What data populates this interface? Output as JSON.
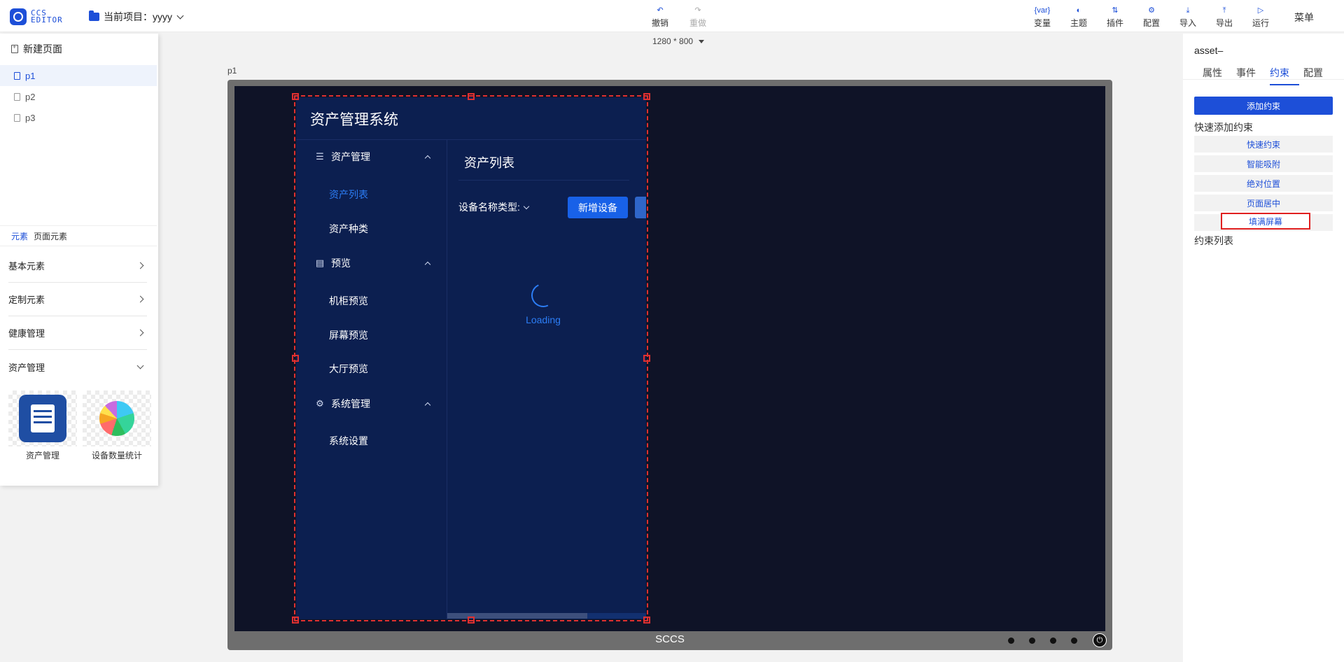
{
  "app": {
    "logo_text": "CCS EDITOR",
    "project_label": "当前项目：yyyy"
  },
  "toolbar": {
    "undo": "撤销",
    "redo": "重做",
    "variable": "变量",
    "theme": "主题",
    "plugin": "插件",
    "config": "配置",
    "import": "导入",
    "export": "导出",
    "run": "运行",
    "menu": "菜单"
  },
  "icons": {
    "undo": "undo-icon",
    "redo": "redo-icon",
    "variable": "var-icon",
    "theme": "palette-icon",
    "plugin": "plugin-icon",
    "config": "gear-icon",
    "import": "download-icon",
    "export": "upload-icon",
    "run": "play-icon"
  },
  "left": {
    "new_page": "新建页面",
    "pages": [
      "p1",
      "p2",
      "p3"
    ],
    "tabs": [
      "元素",
      "页面元素"
    ],
    "categories": [
      "基本元素",
      "定制元素",
      "健康管理",
      "资产管理"
    ],
    "tiles": [
      "资产管理",
      "设备数量统计"
    ]
  },
  "canvas": {
    "size": "1280 * 800",
    "page_label": "p1",
    "monitor_brand": "SCCS"
  },
  "preview": {
    "title": "资产管理系统",
    "menu": {
      "group1": "资产管理",
      "item_list": "资产列表",
      "item_kind": "资产种类",
      "group2": "预览",
      "item_cabinet": "机柜预览",
      "item_screen": "屏幕预览",
      "item_hall": "大厅预览",
      "group3": "系统管理",
      "item_settings": "系统设置"
    },
    "content_title": "资产列表",
    "filter_label": "设备名称类型:",
    "add_button": "新增设备",
    "loading": "Loading"
  },
  "right": {
    "title": "asset–",
    "tabs": [
      "属性",
      "事件",
      "约束",
      "配置"
    ],
    "add_constraint": "添加约束",
    "quick_label": "快速添加约束",
    "quick_buttons": [
      "快速约束",
      "智能吸附",
      "绝对位置",
      "页面居中",
      "填满屏幕"
    ],
    "list_label": "约束列表"
  },
  "colors": {
    "accent": "#1d4fd8",
    "app_bg": "#0c1f50",
    "screen_bg": "#0f1327",
    "selection": "#e03030"
  }
}
